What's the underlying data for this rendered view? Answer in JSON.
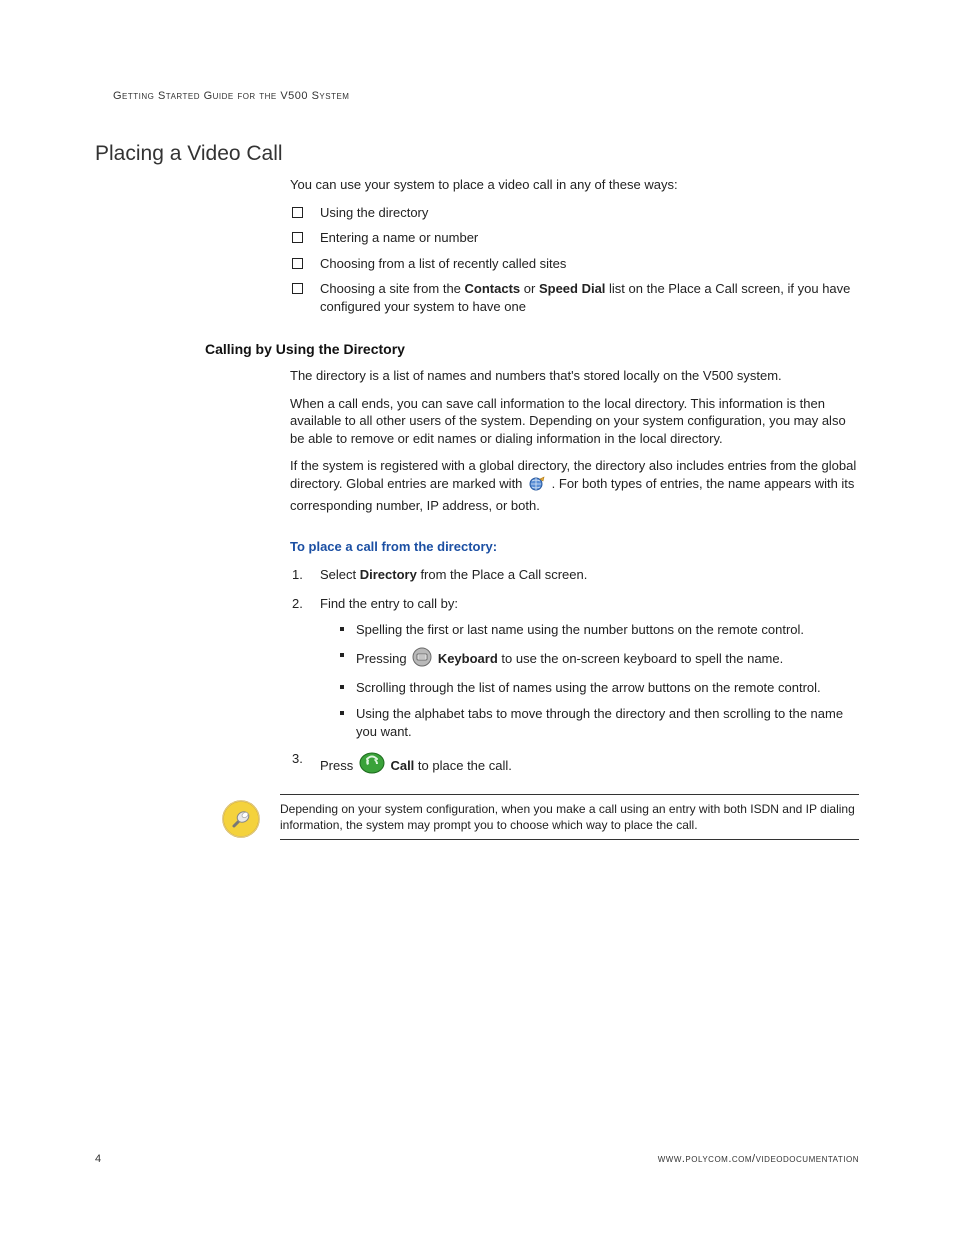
{
  "running_header": "Getting Started Guide for the V500 System",
  "h1": "Placing a Video Call",
  "intro": "You can use your system to place a video call in any of these ways:",
  "checklist": [
    {
      "text": "Using the directory"
    },
    {
      "text": "Entering a name or number"
    },
    {
      "text": "Choosing from a list of recently called sites"
    },
    {
      "pre": "Choosing a site from the ",
      "b1": "Contacts",
      "mid": " or ",
      "b2": "Speed Dial",
      "post": " list on the Place a Call screen, if you have configured your system to have one"
    }
  ],
  "h2": "Calling by Using the Directory",
  "dir_p1": "The directory is a list of names and numbers that's stored locally on the V500 system.",
  "dir_p2": "When a call ends, you can save call information to the local directory. This information is then available to all other users of the system. Depending on your system configuration, you may also be able to remove or edit names or dialing information in the local directory.",
  "dir_p3a": "If the system is registered with a global directory, the directory also includes entries from the global directory. Global entries are marked with ",
  "dir_p3b": ". For both types of entries, the name appears with its corresponding number, IP address, or both.",
  "blue_head": "To place a call from the directory:",
  "step1_pre": "Select ",
  "step1_b": "Directory",
  "step1_post": " from the Place a Call screen.",
  "step2": "Find the entry to call by:",
  "step2_items": {
    "a": "Spelling the first or last name using the number buttons on the remote control.",
    "b_pre": "Pressing ",
    "b_bold": " Keyboard",
    "b_post": " to use the on-screen keyboard to spell the name.",
    "c": "Scrolling through the list of names using the arrow buttons on the remote control.",
    "d": "Using the alphabet tabs to move through the directory and then scrolling to the name you want."
  },
  "step3_pre": "Press ",
  "step3_bold": " Call",
  "step3_post": " to place the call.",
  "note": "Depending on your system configuration, when you make a call using an entry with both ISDN and IP dialing information, the system may prompt you to choose which way to place the call.",
  "page_number": "4",
  "footer_url": "www.polycom.com/videodocumentation"
}
